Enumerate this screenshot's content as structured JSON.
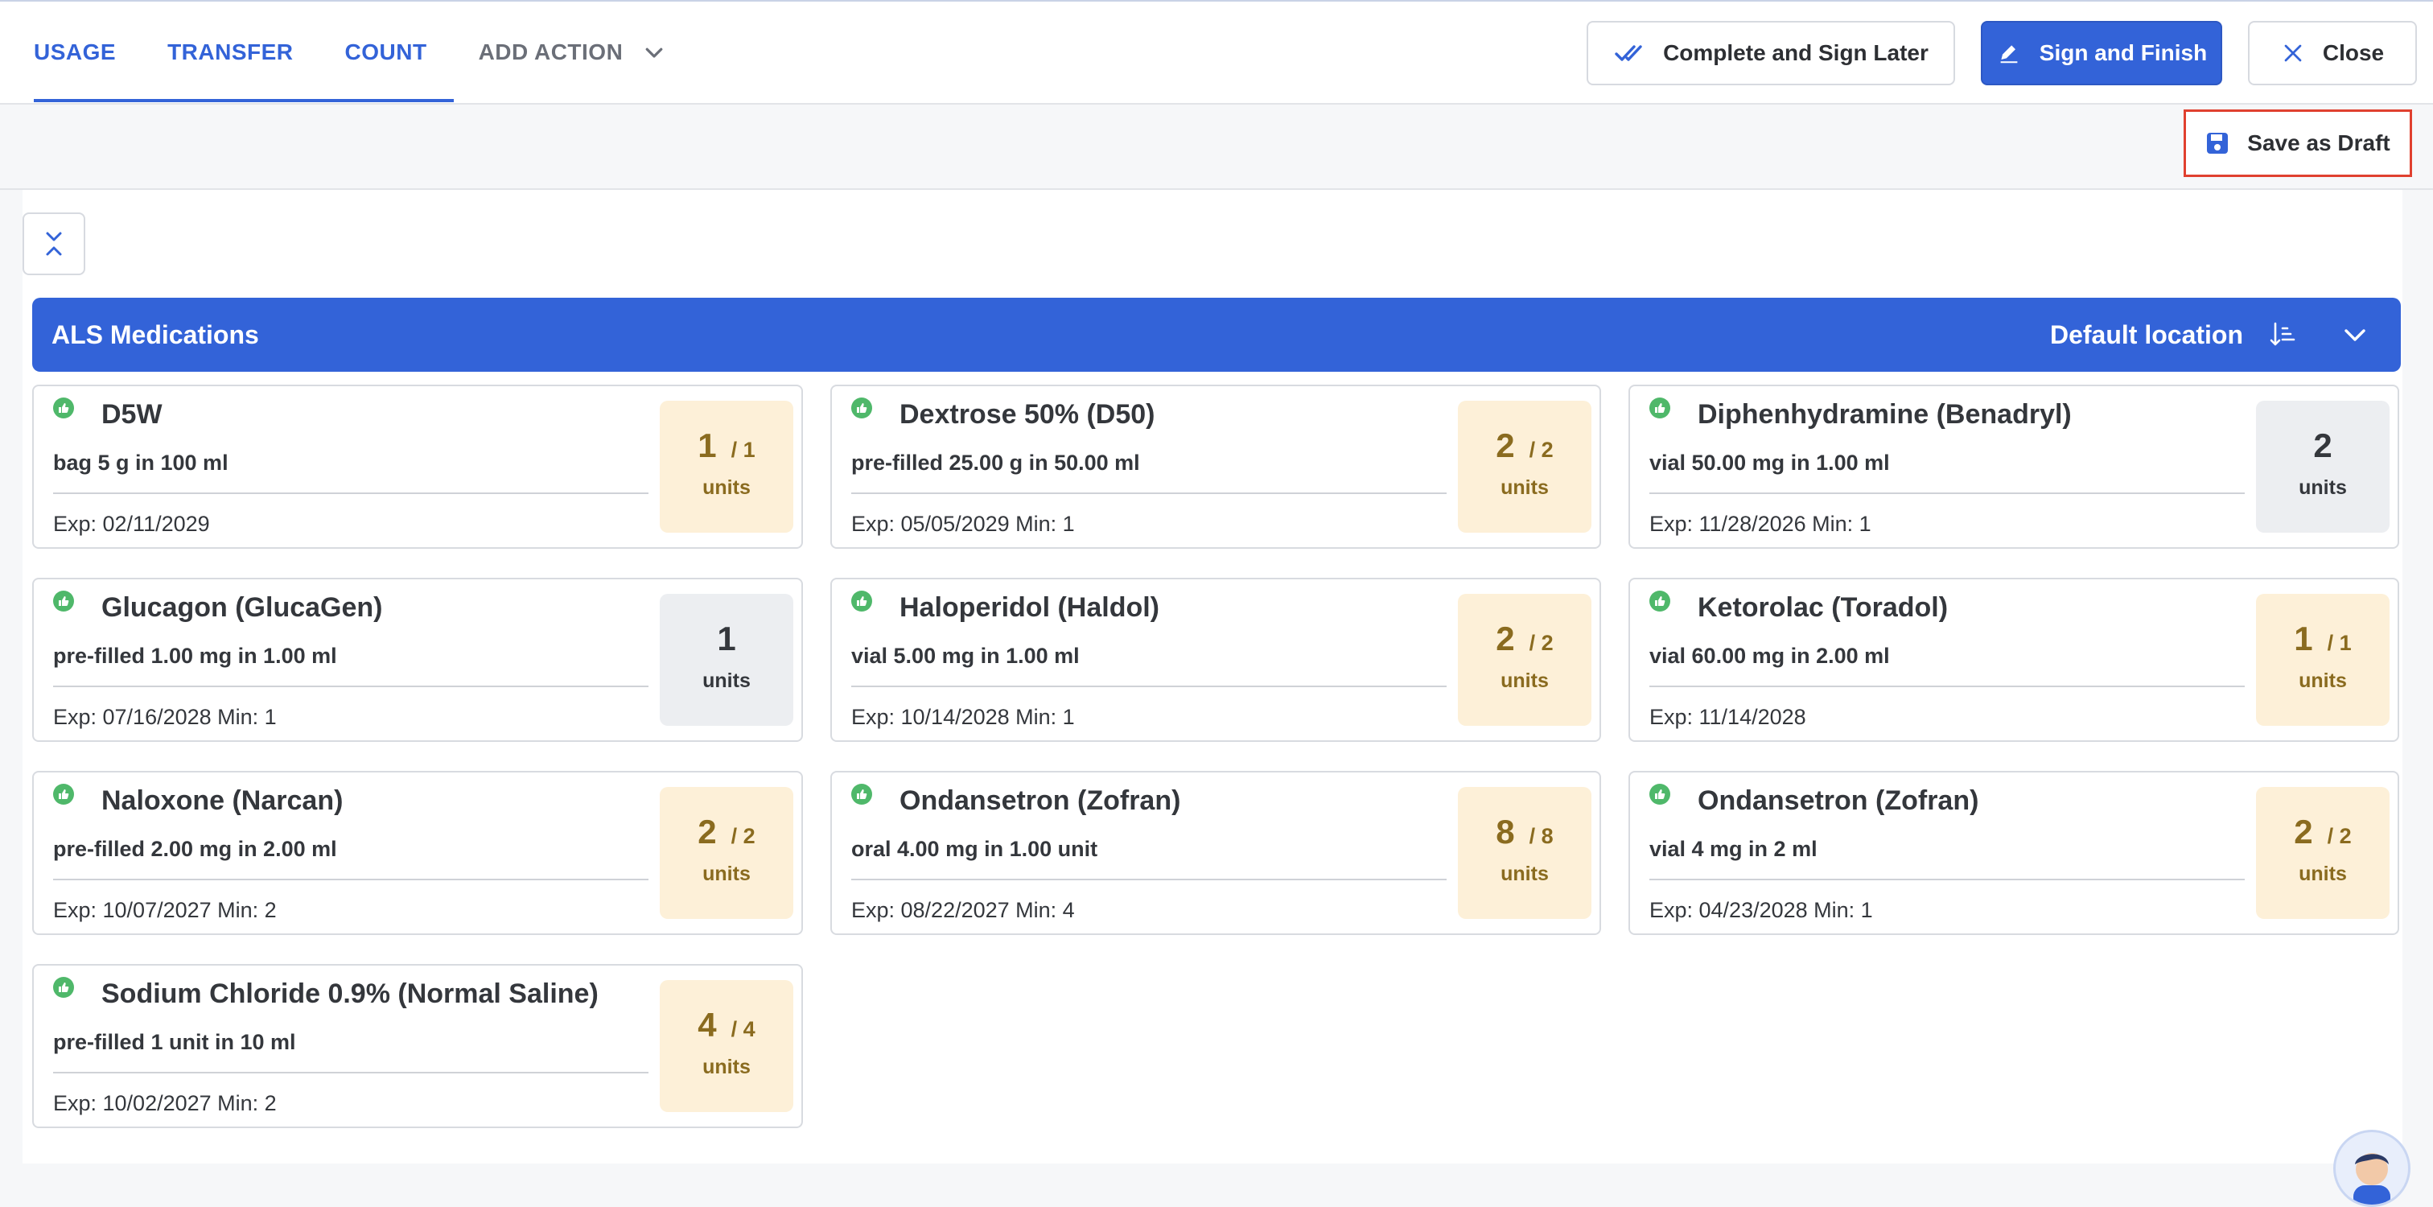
{
  "tabs": [
    {
      "label": "USAGE"
    },
    {
      "label": "TRANSFER"
    },
    {
      "label": "COUNT"
    }
  ],
  "add_action": {
    "label": "ADD ACTION"
  },
  "header_buttons": {
    "complete_later": "Complete and Sign Later",
    "sign_finish": "Sign and Finish",
    "close": "Close"
  },
  "toolbar": {
    "save_draft": "Save as Draft"
  },
  "section": {
    "title": "ALS Medications",
    "location": "Default location"
  },
  "units_label": "units",
  "colors": {
    "primary": "#3363d8",
    "status_ok": "#4fb86a",
    "qty_bg": "#fdf0d8",
    "qty_text": "#8a6b1f",
    "highlight": "#e0402f"
  },
  "medications": [
    {
      "name": "D5W",
      "desc": "bag 5 g in 100 ml",
      "exp": "Exp: 02/11/2029",
      "count": "1",
      "total": "/ 1"
    },
    {
      "name": "Dextrose 50% (D50)",
      "desc": "pre-filled 25.00 g in 50.00 ml",
      "exp": "Exp: 05/05/2029  Min: 1",
      "count": "2",
      "total": "/ 2"
    },
    {
      "name": "Diphenhydramine (Benadryl)",
      "desc": "vial 50.00 mg in 1.00 ml",
      "exp": "Exp: 11/28/2026 Min: 1",
      "count": "2",
      "total": ""
    },
    {
      "name": "Glucagon (GlucaGen)",
      "desc": "pre-filled 1.00 mg in 1.00 ml",
      "exp": "Exp: 07/16/2028 Min: 1",
      "count": "1",
      "total": ""
    },
    {
      "name": "Haloperidol (Haldol)",
      "desc": "vial 5.00 mg in 1.00 ml",
      "exp": "Exp: 10/14/2028  Min: 1",
      "count": "2",
      "total": "/ 2"
    },
    {
      "name": "Ketorolac (Toradol)",
      "desc": "vial 60.00 mg in 2.00 ml",
      "exp": "Exp: 11/14/2028",
      "count": "1",
      "total": "/ 1"
    },
    {
      "name": "Naloxone (Narcan)",
      "desc": "pre-filled 2.00 mg in 2.00 ml",
      "exp": "Exp: 10/07/2027 Min: 2",
      "count": "2",
      "total": "/ 2"
    },
    {
      "name": "Ondansetron (Zofran)",
      "desc": "oral 4.00 mg in 1.00 unit",
      "exp": "Exp: 08/22/2027  Min: 4",
      "count": "8",
      "total": "/ 8"
    },
    {
      "name": "Ondansetron (Zofran)",
      "desc": "vial 4 mg in 2 ml",
      "exp": "Exp: 04/23/2028  Min: 1",
      "count": "2",
      "total": "/ 2"
    },
    {
      "name": "Sodium Chloride 0.9% (Normal Saline)",
      "desc": "pre-filled 1 unit in 10 ml",
      "exp": "Exp: 10/02/2027  Min: 2",
      "count": "4",
      "total": "/ 4"
    }
  ]
}
